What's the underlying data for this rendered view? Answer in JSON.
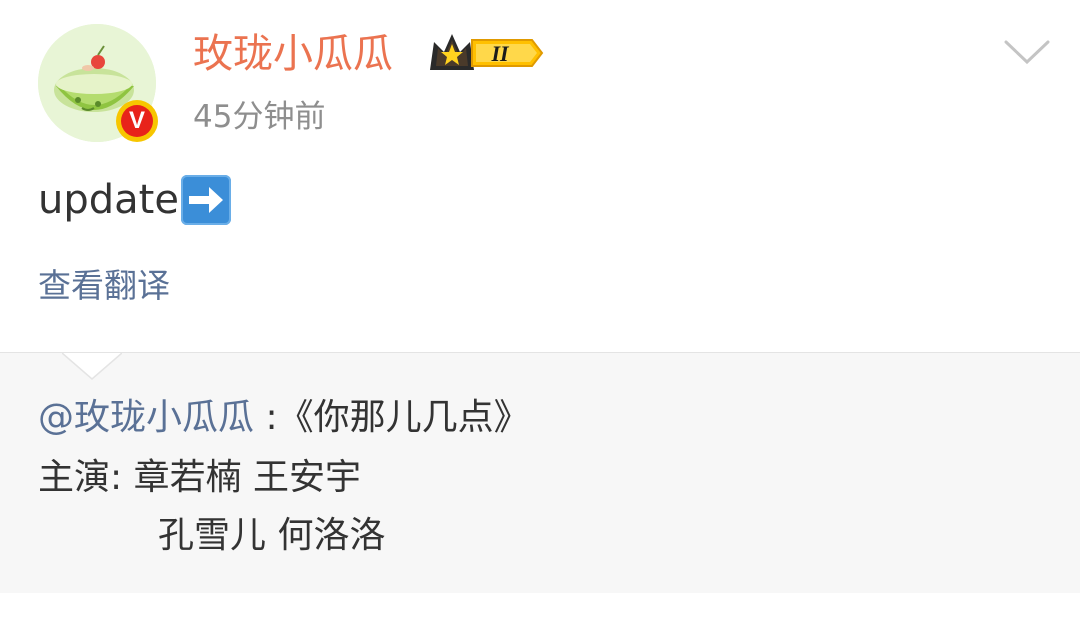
{
  "post": {
    "author": {
      "name": "玫珑小瓜瓜",
      "verified_icon": "verified-v-badge",
      "vip_level": "II",
      "vip_icon": "crown-icon"
    },
    "time": "45分钟前",
    "text": "update",
    "text_emoji": "right-arrow-emoji",
    "translate_label": "查看翻译",
    "menu_icon": "chevron-down-icon"
  },
  "repost": {
    "mention": "@玫珑小瓜瓜",
    "separator": " :",
    "title": "《你那儿几点》",
    "cast_label": "主演:",
    "cast_line1": "章若楠 王安宇",
    "cast_line2": "孔雪儿 何洛洛"
  },
  "colors": {
    "username": "#eb7350",
    "link": "#5a7196",
    "meta": "#8e8e8e",
    "repost_bg": "#f7f7f7"
  }
}
